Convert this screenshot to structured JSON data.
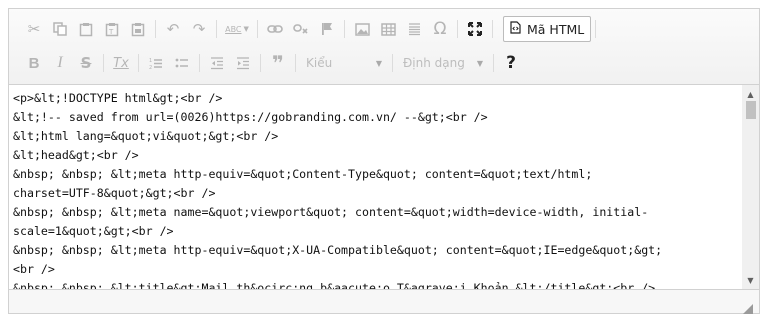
{
  "toolbar": {
    "row1": [
      {
        "icon": "cut-icon",
        "glyph": "✂"
      },
      {
        "icon": "copy-icon",
        "glyph": "⎘"
      },
      {
        "icon": "paste-icon",
        "glyph": "📋"
      },
      {
        "icon": "paste-text-icon",
        "glyph": "📋"
      },
      {
        "icon": "paste-word-icon",
        "glyph": "📋"
      },
      {
        "icon": "undo-icon",
        "glyph": "↶"
      },
      {
        "icon": "redo-icon",
        "glyph": "↷"
      },
      {
        "icon": "spellcheck-icon",
        "glyph": "ABC"
      },
      {
        "icon": "link-icon",
        "glyph": "🔗"
      },
      {
        "icon": "unlink-icon",
        "glyph": "⛓"
      },
      {
        "icon": "anchor-flag-icon",
        "glyph": "⚑"
      },
      {
        "icon": "image-icon",
        "glyph": "🖼"
      },
      {
        "icon": "table-icon",
        "glyph": "▦"
      },
      {
        "icon": "horizontal-line-icon",
        "glyph": "☰"
      },
      {
        "icon": "special-char-icon",
        "glyph": "Ω"
      },
      {
        "icon": "maximize-icon",
        "glyph": "⛶"
      }
    ],
    "source_label": "Mã HTML",
    "row2": [
      {
        "icon": "bold-icon",
        "glyph": "B"
      },
      {
        "icon": "italic-icon",
        "glyph": "I"
      },
      {
        "icon": "strike-icon",
        "glyph": "S"
      },
      {
        "icon": "remove-format-icon",
        "glyph": "Tx"
      },
      {
        "icon": "numbered-list-icon",
        "glyph": "1≡"
      },
      {
        "icon": "bulleted-list-icon",
        "glyph": "•≡"
      },
      {
        "icon": "outdent-icon",
        "glyph": "⇤"
      },
      {
        "icon": "indent-icon",
        "glyph": "⇥"
      },
      {
        "icon": "blockquote-icon",
        "glyph": "❞"
      }
    ],
    "style_combo": "Kiểu",
    "format_combo": "Định dạng",
    "help_glyph": "?"
  },
  "source_lines": [
    "<p>&lt;!DOCTYPE html&gt;<br />",
    "&lt;!-- saved from url=(0026)https://gobranding.com.vn/ --&gt;<br />",
    "&lt;html lang=&quot;vi&quot;&gt;<br />",
    "&lt;head&gt;<br />",
    "&nbsp; &nbsp; &lt;meta http-equiv=&quot;Content-Type&quot; content=&quot;text/html;",
    "charset=UTF-8&quot;&gt;<br />",
    "&nbsp; &nbsp; &lt;meta name=&quot;viewport&quot; content=&quot;width=device-width, initial-",
    "scale=1&quot;&gt;<br />",
    "&nbsp; &nbsp; &lt;meta http-equiv=&quot;X-UA-Compatible&quot; content=&quot;IE=edge&quot;&gt;",
    "<br />",
    "&nbsp; &nbsp; &lt;title&gt;Mail th&ocirc;ng b&aacute;o T&agrave;i Khoản &lt;/title&gt;<br />"
  ]
}
